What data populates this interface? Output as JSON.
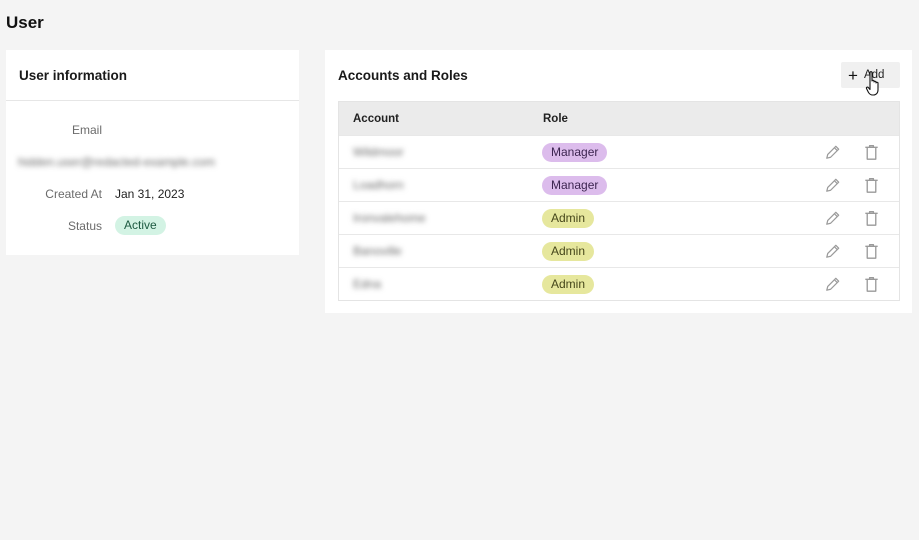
{
  "page": {
    "title": "User"
  },
  "user_card": {
    "title": "User information",
    "email_label": "Email",
    "email_value": "hidden.user@redacted-example.com",
    "created_label": "Created At",
    "created_value": "Jan 31, 2023",
    "status_label": "Status",
    "status_value": "Active"
  },
  "accounts_card": {
    "title": "Accounts and Roles",
    "add_label": "Add",
    "columns": {
      "account": "Account",
      "role": "Role"
    },
    "rows": [
      {
        "account": "Wildmoor",
        "role": "Manager"
      },
      {
        "account": "Loadhorn",
        "role": "Manager"
      },
      {
        "account": "Ironvalehome",
        "role": "Admin"
      },
      {
        "account": "Banoville",
        "role": "Admin"
      },
      {
        "account": "Edna",
        "role": "Admin"
      }
    ]
  },
  "icons": {
    "add": "plus-icon",
    "edit": "pencil-icon",
    "delete": "trash-icon"
  },
  "colors": {
    "active_badge": "#d3f3e4",
    "manager_badge": "#dcbcec",
    "admin_badge": "#e6e79d",
    "header_bg": "#ebebeb"
  }
}
